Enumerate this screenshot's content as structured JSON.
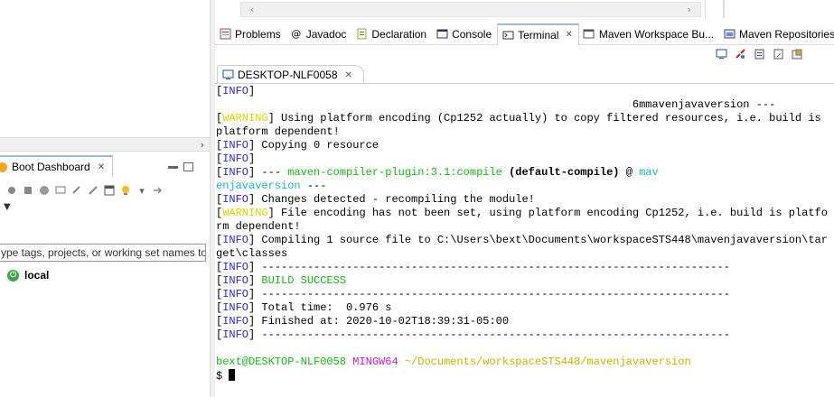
{
  "left": {
    "boot_tab_label": "Boot Dashboard",
    "boot_tab_close": "✕",
    "filter_placeholder": "ype tags, projects, or working set names to",
    "local_label": "local",
    "scroll_right_arrow": "›"
  },
  "top_scroll": {
    "left_arrow": "‹",
    "right_arrow": "›"
  },
  "view_tabs": [
    {
      "label": "Problems"
    },
    {
      "label": "Javadoc"
    },
    {
      "label": "Declaration"
    },
    {
      "label": "Console"
    },
    {
      "label": "Terminal",
      "close": "✕"
    },
    {
      "label": "Maven Workspace Bu..."
    },
    {
      "label": "Maven Repositories"
    }
  ],
  "terminal_tab": {
    "label": "DESKTOP-NLF0058",
    "close": "✕"
  },
  "terminal_lines": [
    {
      "segments": [
        {
          "t": "["
        },
        {
          "t": "INFO",
          "c": "info"
        },
        {
          "t": "]"
        }
      ]
    },
    {
      "segments": [
        {
          "t": "                                                                6mmavenjavaversion ---"
        }
      ]
    },
    {
      "segments": [
        {
          "t": "["
        },
        {
          "t": "WARNING",
          "c": "warn"
        },
        {
          "t": "] Using platform encoding (Cp1252 actually) to copy filtered resources, i.e. build is"
        }
      ]
    },
    {
      "segments": [
        {
          "t": "platform dependent!"
        }
      ]
    },
    {
      "segments": [
        {
          "t": "["
        },
        {
          "t": "INFO",
          "c": "info"
        },
        {
          "t": "] Copying 0 resource"
        }
      ]
    },
    {
      "segments": [
        {
          "t": "["
        },
        {
          "t": "INFO",
          "c": "info"
        },
        {
          "t": "]"
        }
      ]
    },
    {
      "segments": [
        {
          "t": "["
        },
        {
          "t": "INFO",
          "c": "info"
        },
        {
          "t": "] --- "
        },
        {
          "t": "maven-compiler-plugin:3.1:compile",
          "c": "green"
        },
        {
          "t": " "
        },
        {
          "t": "(default-compile)",
          "c": "bold"
        },
        {
          "t": " @ "
        },
        {
          "t": "mav",
          "c": "cyan"
        }
      ]
    },
    {
      "segments": [
        {
          "t": "enjavaversion",
          "c": "cyan"
        },
        {
          "t": " ---"
        }
      ]
    },
    {
      "segments": [
        {
          "t": "["
        },
        {
          "t": "INFO",
          "c": "info"
        },
        {
          "t": "] Changes detected - recompiling the module!"
        }
      ]
    },
    {
      "segments": [
        {
          "t": "["
        },
        {
          "t": "WARNING",
          "c": "warn"
        },
        {
          "t": "] File encoding has not been set, using platform encoding Cp1252, i.e. build is platfo"
        }
      ]
    },
    {
      "segments": [
        {
          "t": "rm dependent!"
        }
      ]
    },
    {
      "segments": [
        {
          "t": "["
        },
        {
          "t": "INFO",
          "c": "info"
        },
        {
          "t": "] Compiling 1 source file to C:\\Users\\bext\\Documents\\workspaceSTS448\\mavenjavaversion\\tar"
        }
      ]
    },
    {
      "segments": [
        {
          "t": "get\\classes"
        }
      ]
    },
    {
      "segments": [
        {
          "t": "["
        },
        {
          "t": "INFO",
          "c": "info"
        },
        {
          "t": "] ------------------------------------------------------------------------"
        }
      ]
    },
    {
      "segments": [
        {
          "t": "["
        },
        {
          "t": "INFO",
          "c": "info"
        },
        {
          "t": "] "
        },
        {
          "t": "BUILD SUCCESS",
          "c": "green"
        }
      ]
    },
    {
      "segments": [
        {
          "t": "["
        },
        {
          "t": "INFO",
          "c": "info"
        },
        {
          "t": "] ------------------------------------------------------------------------"
        }
      ]
    },
    {
      "segments": [
        {
          "t": "["
        },
        {
          "t": "INFO",
          "c": "info"
        },
        {
          "t": "] Total time:  0.976 s"
        }
      ]
    },
    {
      "segments": [
        {
          "t": "["
        },
        {
          "t": "INFO",
          "c": "info"
        },
        {
          "t": "] Finished at: 2020-10-02T18:39:31-05:00"
        }
      ]
    },
    {
      "segments": [
        {
          "t": "["
        },
        {
          "t": "INFO",
          "c": "info"
        },
        {
          "t": "] ------------------------------------------------------------------------"
        }
      ]
    },
    {
      "segments": [
        {
          "t": ""
        }
      ]
    },
    {
      "segments": [
        {
          "t": "bext@DESKTOP-NLF0058",
          "c": "green"
        },
        {
          "t": " "
        },
        {
          "t": "MINGW64",
          "c": "mag"
        },
        {
          "t": " "
        },
        {
          "t": "~/Documents/workspaceSTS448/mavenjavaversion",
          "c": "yel"
        }
      ]
    },
    {
      "segments": [
        {
          "t": "$ "
        }
      ],
      "cursor": true
    }
  ]
}
